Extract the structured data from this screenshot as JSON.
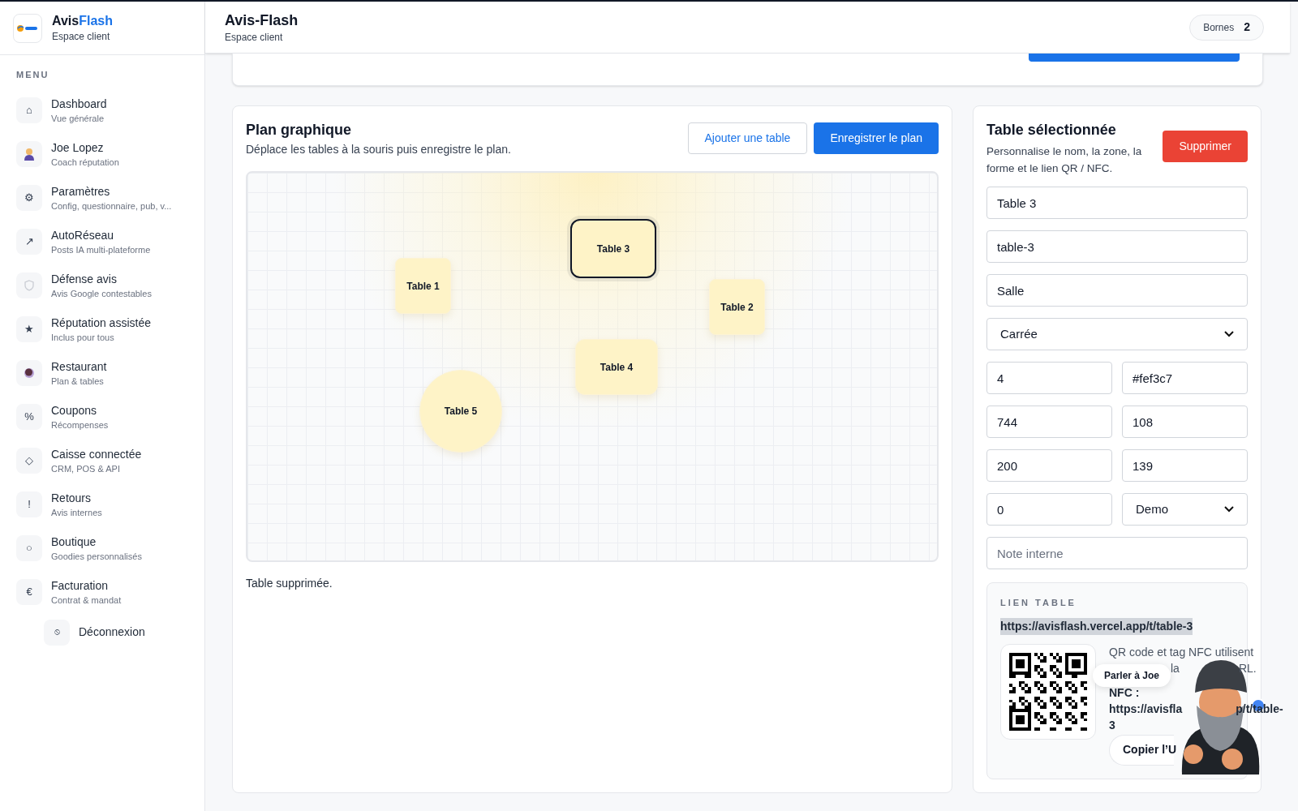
{
  "sidebar": {
    "brand": {
      "part1": "Avis",
      "part2": "Flash"
    },
    "subtitle": "Espace client",
    "menu_label": "MENU",
    "items": [
      {
        "kind": "glyph",
        "icon": "⌂",
        "label": "Dashboard",
        "sub": "Vue générale"
      },
      {
        "kind": "avatar",
        "label": "Joe Lopez",
        "sub": "Coach réputation"
      },
      {
        "kind": "glyph",
        "icon": "⚙",
        "label": "Paramètres",
        "sub": "Config, questionnaire, pub, v..."
      },
      {
        "kind": "glyph",
        "icon": "↗",
        "label": "AutoRéseau",
        "sub": "Posts IA multi-plateforme"
      },
      {
        "kind": "shield",
        "label": "Défense avis",
        "sub": "Avis Google contestables"
      },
      {
        "kind": "glyph",
        "icon": "★",
        "label": "Réputation assistée",
        "sub": "Inclus pour tous"
      },
      {
        "kind": "dish",
        "label": "Restaurant",
        "sub": "Plan & tables"
      },
      {
        "kind": "glyph",
        "icon": "%",
        "label": "Coupons",
        "sub": "Récompenses"
      },
      {
        "kind": "glyph",
        "icon": "◇",
        "label": "Caisse connectée",
        "sub": "CRM, POS & API"
      },
      {
        "kind": "glyph",
        "icon": "!",
        "label": "Retours",
        "sub": "Avis internes"
      },
      {
        "kind": "glyph",
        "icon": "○",
        "label": "Boutique",
        "sub": "Goodies personnalisés"
      },
      {
        "kind": "glyph",
        "icon": "€",
        "label": "Facturation",
        "sub": "Contrat & mandat"
      }
    ],
    "logout": {
      "icon": "⦸",
      "label": "Déconnexion"
    }
  },
  "header": {
    "title": "Avis-Flash",
    "subtitle": "Espace client",
    "pill_label": "Bornes",
    "pill_count": "2"
  },
  "plan": {
    "title": "Plan graphique",
    "subtitle": "Déplace les tables à la souris puis enregistre le plan.",
    "add_button": "Ajouter une table",
    "save_button": "Enregistrer le plan",
    "tables": [
      {
        "label": "Table 1",
        "kind": "square",
        "selected": false
      },
      {
        "label": "Table 3",
        "kind": "rect",
        "selected": true
      },
      {
        "label": "Table 2",
        "kind": "square",
        "selected": false
      },
      {
        "label": "Table 4",
        "kind": "rect",
        "selected": false
      },
      {
        "label": "Table 5",
        "kind": "round",
        "selected": false
      }
    ],
    "status": "Table supprimée."
  },
  "selected_table": {
    "title": "Table sélectionnée",
    "subtitle": "Personnalise le nom, la zone, la forme et le lien QR / NFC.",
    "delete_button": "Supprimer",
    "fields": [
      {
        "kind": "input",
        "value": "Table 3"
      },
      {
        "kind": "input",
        "value": "table-3"
      },
      {
        "kind": "input",
        "value": "Salle"
      },
      {
        "kind": "select",
        "value": "Carrée"
      },
      {
        "kind": "input",
        "value": "4"
      },
      {
        "kind": "input",
        "value": "#fef3c7"
      },
      {
        "kind": "input",
        "value": "744"
      },
      {
        "kind": "input",
        "value": "108"
      },
      {
        "kind": "input",
        "value": "200"
      },
      {
        "kind": "input",
        "value": "139"
      },
      {
        "kind": "input",
        "value": "0"
      },
      {
        "kind": "select",
        "value": "Demo"
      },
      {
        "kind": "input",
        "placeholder": "Note interne"
      }
    ],
    "link": {
      "label": "LIEN TABLE",
      "url": "https://avisflash.vercel.app/t/table-3",
      "desc_line1": "QR code et tag NFC utilisent",
      "desc_frag1": "la",
      "desc_frag2": "RL.",
      "nfc_label": "NFC :",
      "nfc_frag1": "https://avisfla",
      "nfc_frag2": "p/t/table-",
      "nfc_line3": "3",
      "copy_button": "Copier l’U"
    }
  },
  "assistant": {
    "bubble": "Parler à Joe"
  }
}
